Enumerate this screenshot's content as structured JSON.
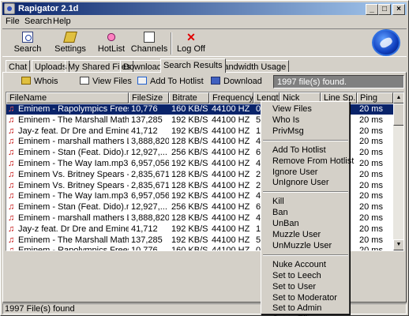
{
  "window": {
    "title": "Rapigator 2.1d"
  },
  "menubar": {
    "items": [
      "File",
      "Search",
      "Help"
    ]
  },
  "toolbar": {
    "buttons": [
      {
        "label": "Search",
        "icon": "search-icon"
      },
      {
        "label": "Settings",
        "icon": "settings-icon"
      },
      {
        "label": "HotList",
        "icon": "hotlist-icon"
      },
      {
        "label": "Channels",
        "icon": "channels-icon"
      },
      {
        "label": "Log Off",
        "icon": "logoff-icon"
      }
    ]
  },
  "tabs": [
    {
      "label": "Chat"
    },
    {
      "label": "Uploads"
    },
    {
      "label": "My Shared Files"
    },
    {
      "label": "Downloads"
    },
    {
      "label": "Search Results",
      "active": true
    },
    {
      "label": "Bandwidth Usage"
    }
  ],
  "actions": {
    "whois": "Whois",
    "view_files": "View Files",
    "add_hotlist": "Add To Hotlist",
    "download": "Download",
    "found": "1997 file(s) found."
  },
  "table": {
    "columns": [
      "FileName",
      "FileSize",
      "Bitrate",
      "Frequency",
      "Length",
      "Nick",
      "Line Sp...",
      "Ping"
    ],
    "rows": [
      [
        "Eminem - Rapolympics Freestyle (...",
        "10,776",
        "160 KB/S",
        "44100 HZ",
        "0:00",
        "",
        "",
        "20 ms"
      ],
      [
        "Eminem - The Marshall Mathers LP ...",
        "137,285",
        "192 KB/S",
        "44100 HZ",
        "5:",
        "",
        "",
        "20 ms"
      ],
      [
        "Jay-z feat. Dr Dre and Eminem - Bi...",
        "41,712",
        "192 KB/S",
        "44100 HZ",
        "1:",
        "",
        "",
        "20 ms"
      ],
      [
        "Eminem - marshall mathers LP - bit...",
        "3,888,820",
        "128 KB/S",
        "44100 HZ",
        "4:",
        "",
        "",
        "20 ms"
      ],
      [
        "Eminem - Stan (Feat. Dido).mp3",
        "12,927,...",
        "256 KB/S",
        "44100 HZ",
        "6:",
        "",
        "",
        "20 ms"
      ],
      [
        "Eminem - The Way Iam.mp3",
        "6,957,056",
        "192 KB/S",
        "44100 HZ",
        "4:",
        "",
        "",
        "20 ms"
      ],
      [
        "Eminem Vs. Britney Spears - My N...",
        "2,835,671",
        "128 KB/S",
        "44100 HZ",
        "2:",
        "",
        "",
        "20 ms"
      ],
      [
        "Eminem Vs. Britney Spears - My N...",
        "2,835,671",
        "128 KB/S",
        "44100 HZ",
        "2:",
        "",
        "",
        "20 ms"
      ],
      [
        "Eminem - The Way Iam.mp3",
        "6,957,056",
        "192 KB/S",
        "44100 HZ",
        "4:",
        "",
        "",
        "20 ms"
      ],
      [
        "Eminem - Stan (Feat. Dido).mp3",
        "12,927,...",
        "256 KB/S",
        "44100 HZ",
        "6:",
        "",
        "",
        "20 ms"
      ],
      [
        "Eminem - marshall mathers LP - bit...",
        "3,888,820",
        "128 KB/S",
        "44100 HZ",
        "4:",
        "",
        "",
        "20 ms"
      ],
      [
        "Jay-z feat. Dr Dre and Eminem - Bi...",
        "41,712",
        "192 KB/S",
        "44100 HZ",
        "1:",
        "",
        "",
        "20 ms"
      ],
      [
        "Eminem - The Marshall Mathers LP ...",
        "137,285",
        "192 KB/S",
        "44100 HZ",
        "5:",
        "",
        "",
        "20 ms"
      ],
      [
        "Eminem - Rapolympics Freestyle (...",
        "10,776",
        "160 KB/S",
        "44100 HZ",
        "0:",
        "",
        "",
        "20 ms"
      ]
    ],
    "selected_row": 0
  },
  "context_menu": {
    "groups": [
      [
        "View Files",
        "Who Is",
        "PrivMsg"
      ],
      [
        "Add To Hotlist",
        "Remove From Hotlist",
        "Ignore User",
        "UnIgnore User"
      ],
      [
        "Kill",
        "Ban",
        "UnBan",
        "Muzzle User",
        "UnMuzzle User"
      ],
      [
        "Nuke Account",
        "Set to Leech",
        "Set to User",
        "Set to Moderator",
        "Set to Admin",
        "Set to Elite"
      ]
    ]
  },
  "status": {
    "text": "1997 File(s) found"
  }
}
